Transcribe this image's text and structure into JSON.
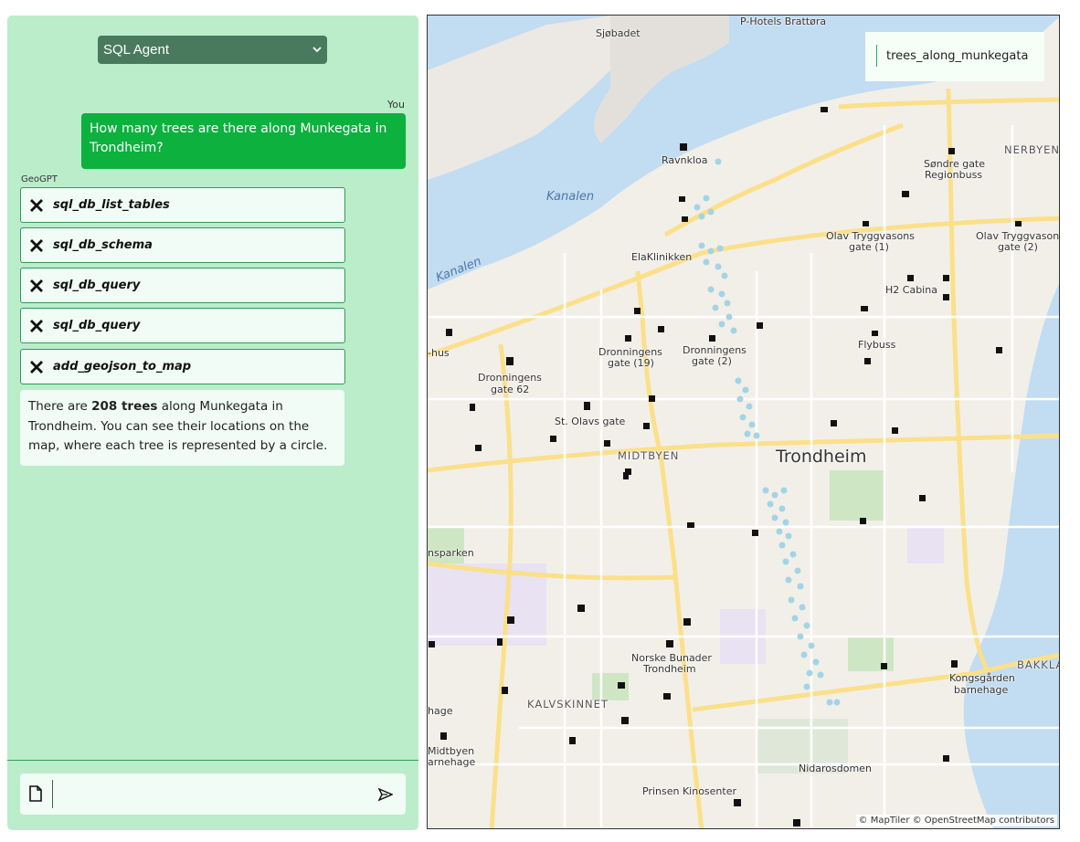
{
  "chat": {
    "agent_select": "SQL Agent",
    "user_label": "You",
    "user_message": "How many trees are there along Munkegata in Trondheim?",
    "bot_label": "GeoGPT",
    "tools": [
      {
        "name": "sql_db_list_tables"
      },
      {
        "name": "sql_db_schema"
      },
      {
        "name": "sql_db_query"
      },
      {
        "name": "sql_db_query"
      },
      {
        "name": "add_geojson_to_map"
      }
    ],
    "answer": {
      "pre": "There are ",
      "bold": "208 trees",
      "post": " along Munkegata in Trondheim. You can see their locations on the map, where each tree is represented by a circle."
    },
    "input_value": ""
  },
  "map": {
    "layer_legend": "trees_along_munkegata",
    "attribution": "© MapTiler © OpenStreetMap contributors",
    "labels": {
      "hotels": "P-Hotels Brattøra",
      "sjobadet": "Sjøbadet",
      "ravnkloa": "Ravnkloa",
      "kanalen1": "Kanalen",
      "kanalen2": "Kanalen",
      "sondre1": "Søndre gate",
      "sondre2": "Regionbuss",
      "nerbyen": "NERBYEN",
      "elaklinikken": "ElaKlinikken",
      "olav1a": "Olav Tryggvasons",
      "olav1b": "gate (1)",
      "olav2a": "Olav Tryggvasons",
      "olav2b": "gate (2)",
      "h2": "H2 Cabina",
      "hus": "-hus",
      "dron19a": "Dronningens",
      "dron19b": "gate (19)",
      "dron2a": "Dronningens",
      "dron2b": "gate (2)",
      "flybuss": "Flybuss",
      "dron62a": "Dronningens",
      "dron62b": "gate 62",
      "olavs": "St. Olavs gate",
      "midtbyen": "MIDTBYEN",
      "trondheim": "Trondheim",
      "nsparken": "nsparken",
      "bunader1": "Norske Bunader",
      "bunader2": "Trondheim",
      "kongs1": "Kongsgården",
      "kongs2": "barnehage",
      "bakkla": "BAKKLA",
      "hage": "hage",
      "kalvskinnet": "KALVSKINNET",
      "midtbyen2a": "Midtbyen",
      "midtbyen2b": "arnehage",
      "nidaros": "Nidarosdomen",
      "prinsen": "Prinsen Kinosenter"
    }
  },
  "colors": {
    "panel_bg": "#bbedcb",
    "user_bubble": "#0cb13e",
    "tool_border": "#2f9a5a",
    "tree_circle": "#a3d4e4",
    "water": "#c2dcf1",
    "road": "#fbe08a"
  }
}
